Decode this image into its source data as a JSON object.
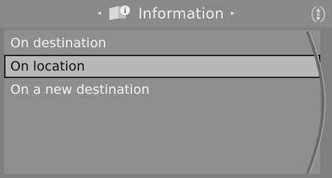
{
  "header": {
    "title": "Information",
    "left_arrow": "◂",
    "right_arrow": "▸",
    "title_icon": "info-book-icon",
    "corner_icon": "controller-icon"
  },
  "menu": {
    "items": [
      {
        "label": "On destination",
        "selected": false
      },
      {
        "label": "On location",
        "selected": true
      },
      {
        "label": "On a new destination",
        "selected": false
      }
    ]
  },
  "colors": {
    "background": "#7f7f7f",
    "titlebar": "#8a8a8a",
    "selected_row": "#b8b8b8",
    "text": "#f2f2f2",
    "selected_text": "#0d0d0d"
  }
}
